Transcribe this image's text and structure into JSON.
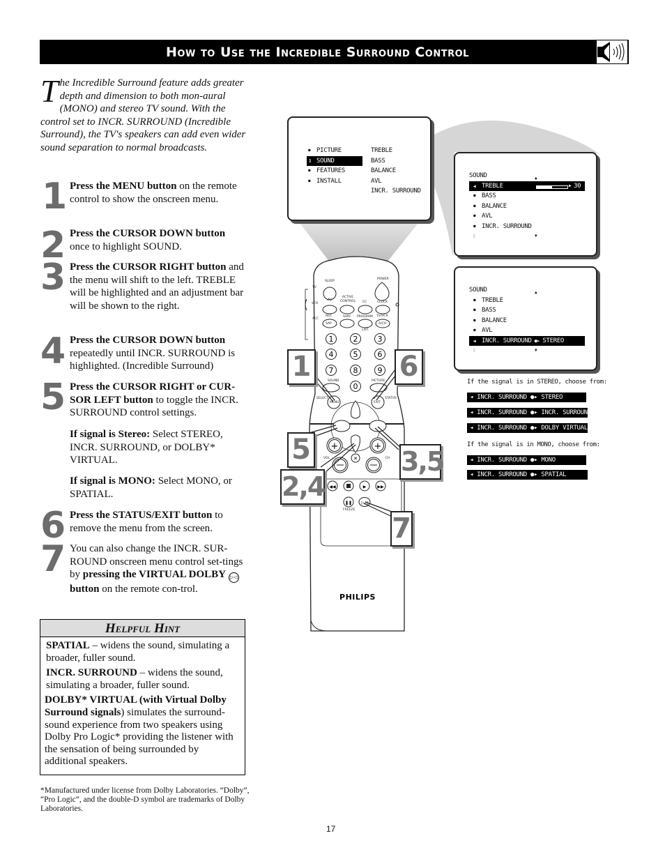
{
  "header": {
    "title": "How to Use the Incredible Surround Control",
    "icon": "speaker-icon"
  },
  "intro": {
    "dropcap": "T",
    "text": "he Incredible Surround feature adds greater depth and dimension to both mon-aural (MONO) and stereo TV sound.  With the control set to INCR. SURROUND (Incredible Surround), the TV's speakers can add even wider sound separation to normal broadcasts."
  },
  "steps": [
    {
      "num": "1",
      "bold": "Press the MENU button",
      "rest": " on the remote control to show the onscreen menu."
    },
    {
      "num": "2",
      "bold": "Press the CURSOR DOWN button",
      "rest": " once to highlight SOUND."
    },
    {
      "num": "3",
      "bold": "Press the CURSOR RIGHT button",
      "rest": " and the menu will shift to the left. TREBLE will be highlighted and an adjustment bar will be shown to the right."
    },
    {
      "num": "4",
      "bold": "Press the CURSOR DOWN button",
      "rest": " repeatedly until INCR. SURROUND is highlighted. (Incredible Surround)"
    },
    {
      "num": "5",
      "bold": "Press the CURSOR RIGHT or CUR-SOR LEFT button",
      "rest": " to toggle the INCR. SURROUND control settings."
    },
    {
      "num": "6",
      "bold": "Press the STATUS/EXIT button",
      "rest": " to remove the menu from the screen."
    },
    {
      "num": "7",
      "pre": "You can also change the INCR. SUR-ROUND onscreen menu control set-tings by ",
      "bold": "pressing the VIRTUAL DOLBY",
      "icon": "virtual-dolby-icon",
      "bold2": " button",
      "rest": " on the remote con-trol."
    }
  ],
  "step5_sub": {
    "stereo_bold": "If signal is Stereo:",
    "stereo_rest": " Select STEREO, INCR. SURROUND, or DOLBY* VIRTUAL.",
    "mono_bold": "If signal is MONO:",
    "mono_rest": " Select MONO, or SPATIAL."
  },
  "hint": {
    "title": "Helpful Hint",
    "items": [
      {
        "bold": "SPATIAL",
        "rest": " – widens the sound, simulating a broader, fuller sound."
      },
      {
        "bold": "INCR. SURROUND",
        "rest": " – widens the sound, simulating a broader, fuller sound."
      },
      {
        "bold": "DOLBY* VIRTUAL (with Virtual Dolby Surround signals",
        "rest": ") simulates the surround-sound experience from two speakers using Dolby Pro Logic* providing the listener with the sensation of being surrounded by additional speakers."
      }
    ]
  },
  "footnote": "*Manufactured under license from Dolby Laboratories. “Dolby”, “Pro Logic”, and the double-D symbol are trademarks of Dolby Laboratories.",
  "page_number": "17",
  "screen_main": {
    "left": [
      "PICTURE",
      "SOUND",
      "FEATURES",
      "INSTALL"
    ],
    "right": [
      "TREBLE",
      "BASS",
      "BALANCE",
      "AVL",
      "INCR.  SURROUND"
    ],
    "selected": "SOUND"
  },
  "screen_treble": {
    "title": "SOUND",
    "items": [
      "TREBLE",
      "BASS",
      "BALANCE",
      "AVL",
      "INCR.  SURROUND"
    ],
    "selected": "TREBLE",
    "value": "30",
    "slider_fraction": 0.5
  },
  "screen_incr": {
    "title": "SOUND",
    "items": [
      "TREBLE",
      "BASS",
      "BALANCE",
      "AVL"
    ],
    "selected": "INCR.  SURROUND",
    "selected_value": "STEREO"
  },
  "options": {
    "stereo_caption": "If the signal is in STEREO, choose from:",
    "stereo": [
      "STEREO",
      "INCR. SURROUND",
      "DOLBY VIRTUAL"
    ],
    "mono_caption": "If the signal is in MONO, choose from:",
    "mono": [
      "MONO",
      "SPATIAL"
    ],
    "prefix": "◂  INCR.  SURROUND  ●▸ "
  },
  "remote": {
    "brand": "PHILIPS",
    "mode_labels": [
      "TV",
      "VCR",
      "ACC"
    ],
    "labels": {
      "sleep": "SLEEP",
      "power": "POWER",
      "av": "AV",
      "active": "ACTIVE CONTROL",
      "cc": "CC",
      "clock": "CLOCK",
      "rec": "REC",
      "sap": "SAP",
      "surf": "SURF",
      "program": "PROGRAM",
      "list": "LIST",
      "tvvcr": "TV/VCR",
      "ach": "A/CH",
      "sound": "SOUND",
      "picture": "PICTURE",
      "select": "SELECT",
      "menu": "MENU",
      "exit": "EXIT",
      "status": "STATUS",
      "vol": "VOL",
      "ch": "CH",
      "freeze": "FREEZE"
    },
    "digits": [
      "1",
      "2",
      "3",
      "4",
      "5",
      "6",
      "7",
      "8",
      "9",
      "0"
    ]
  },
  "callouts": [
    "1",
    "6",
    "5",
    "3,5",
    "2,4",
    "7"
  ]
}
